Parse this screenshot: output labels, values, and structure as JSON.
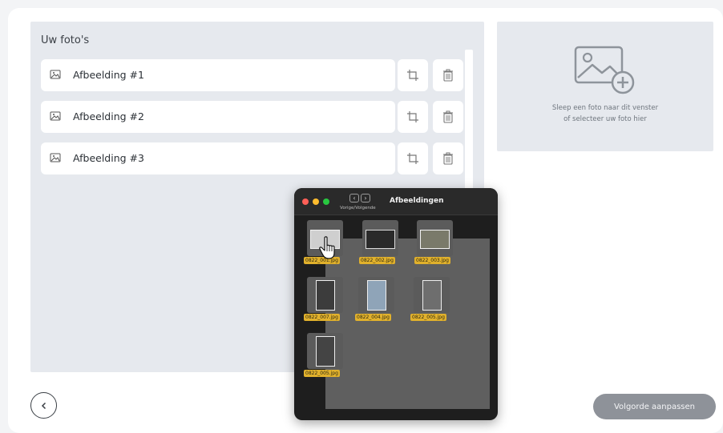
{
  "photos_panel": {
    "title": "Uw foto's",
    "items": [
      {
        "label": "Afbeelding #1"
      },
      {
        "label": "Afbeelding #2"
      },
      {
        "label": "Afbeelding #3"
      }
    ]
  },
  "upload": {
    "line1": "Sleep een foto naar dit venster",
    "line2": "of selecteer uw foto hier"
  },
  "footer": {
    "reorder_label": "Volgorde aanpassen"
  },
  "finder": {
    "title": "Afbeeldingen",
    "nav_label": "Vorige/Volgende",
    "files": [
      {
        "name": "0822_001.jpg"
      },
      {
        "name": "0822_002.jpg"
      },
      {
        "name": "0822_003.jpg"
      },
      {
        "name": "0822_007.jpg"
      },
      {
        "name": "0822_004.jpg"
      },
      {
        "name": "0822_005.jpg"
      },
      {
        "name": "0822_005.jpg"
      }
    ]
  },
  "colors": {
    "file_label_highlight": "#e1b12c",
    "button_grey": "#8e9299",
    "panel_bg": "#e6e9ee"
  }
}
